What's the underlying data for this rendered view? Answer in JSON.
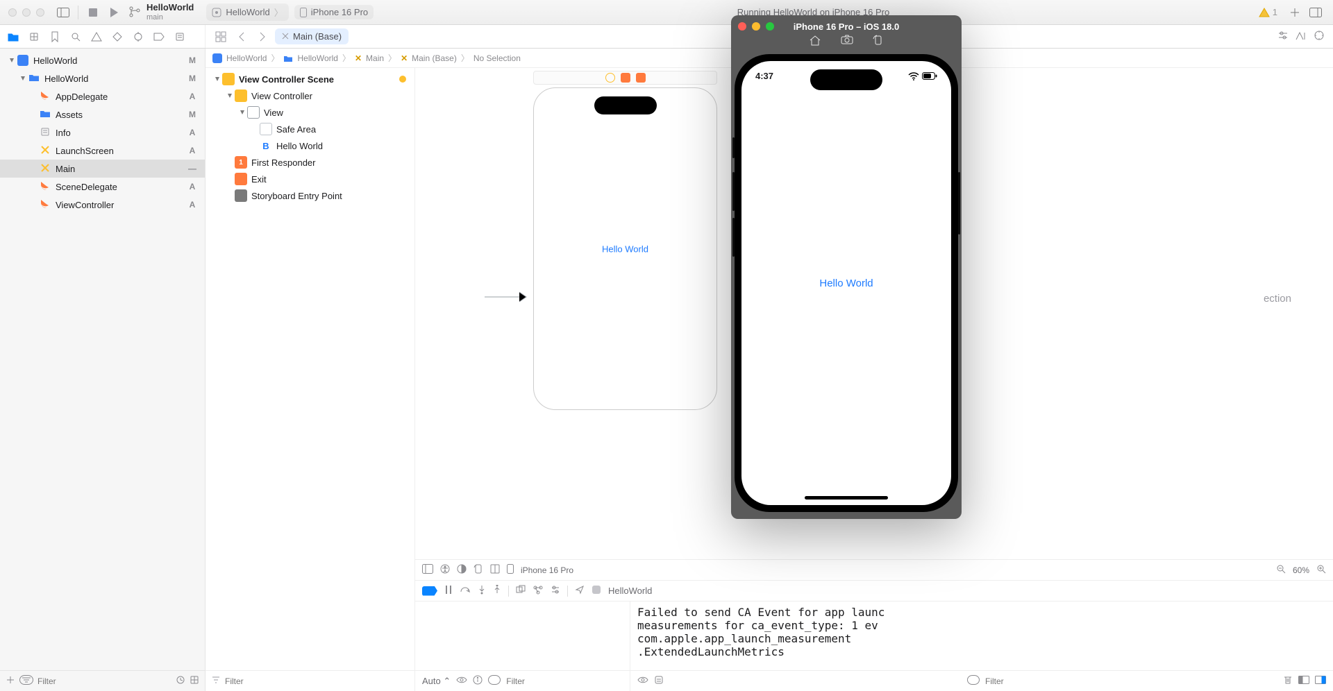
{
  "titlebar": {
    "project": "HelloWorld",
    "branch": "main",
    "scheme_app": "HelloWorld",
    "scheme_device": "iPhone 16 Pro",
    "status": "Running HelloWorld on iPhone 16 Pro",
    "issue_count": "1"
  },
  "jumpbar": {
    "tab_label": "Main (Base)"
  },
  "breadcrumbs": {
    "c1": "HelloWorld",
    "c2": "HelloWorld",
    "c3": "Main",
    "c4": "Main (Base)",
    "c5": "No Selection"
  },
  "navigator": {
    "filter_placeholder": "Filter",
    "items": [
      {
        "label": "HelloWorld",
        "icon": "app",
        "badge": "M",
        "indent": 0,
        "disc": true
      },
      {
        "label": "HelloWorld",
        "icon": "folder",
        "badge": "M",
        "indent": 1,
        "disc": true
      },
      {
        "label": "AppDelegate",
        "icon": "swift",
        "badge": "A",
        "indent": 2
      },
      {
        "label": "Assets",
        "icon": "assets",
        "badge": "M",
        "indent": 2
      },
      {
        "label": "Info",
        "icon": "plist",
        "badge": "A",
        "indent": 2
      },
      {
        "label": "LaunchScreen",
        "icon": "sb",
        "badge": "A",
        "indent": 2
      },
      {
        "label": "Main",
        "icon": "sb",
        "badge": "—",
        "indent": 2,
        "sel": true
      },
      {
        "label": "SceneDelegate",
        "icon": "swift",
        "badge": "A",
        "indent": 2
      },
      {
        "label": "ViewController",
        "icon": "swift",
        "badge": "A",
        "indent": 2
      }
    ]
  },
  "outline": {
    "filter_placeholder": "Filter",
    "items": [
      {
        "label": "View Controller Scene",
        "icon": "scene",
        "indent": 0,
        "disc": true,
        "bold": true,
        "dot": true
      },
      {
        "label": "View Controller",
        "icon": "vc",
        "indent": 1,
        "disc": true
      },
      {
        "label": "View",
        "icon": "view",
        "indent": 2,
        "disc": true
      },
      {
        "label": "Safe Area",
        "icon": "safe",
        "indent": 3
      },
      {
        "label": "Hello World",
        "icon": "btn",
        "indent": 3
      },
      {
        "label": "First Responder",
        "icon": "first",
        "indent": 1
      },
      {
        "label": "Exit",
        "icon": "exit",
        "indent": 1
      },
      {
        "label": "Storyboard Entry Point",
        "icon": "entry",
        "indent": 1
      }
    ]
  },
  "canvas": {
    "button_label": "Hello World",
    "device_label": "iPhone 16 Pro",
    "zoom_label": "60%"
  },
  "debugbar": {
    "target": "HelloWorld"
  },
  "console": {
    "text": "Failed to send CA Event for app launc\nmeasurements for ca_event_type: 1 ev\ncom.apple.app_launch_measurement\n.ExtendedLaunchMetrics",
    "auto_label": "Auto",
    "filter_placeholder": "Filter"
  },
  "simulator": {
    "title": "iPhone 16 Pro – iOS 18.0",
    "time": "4:37",
    "button_label": "Hello World"
  },
  "inspector_hint": "ection"
}
